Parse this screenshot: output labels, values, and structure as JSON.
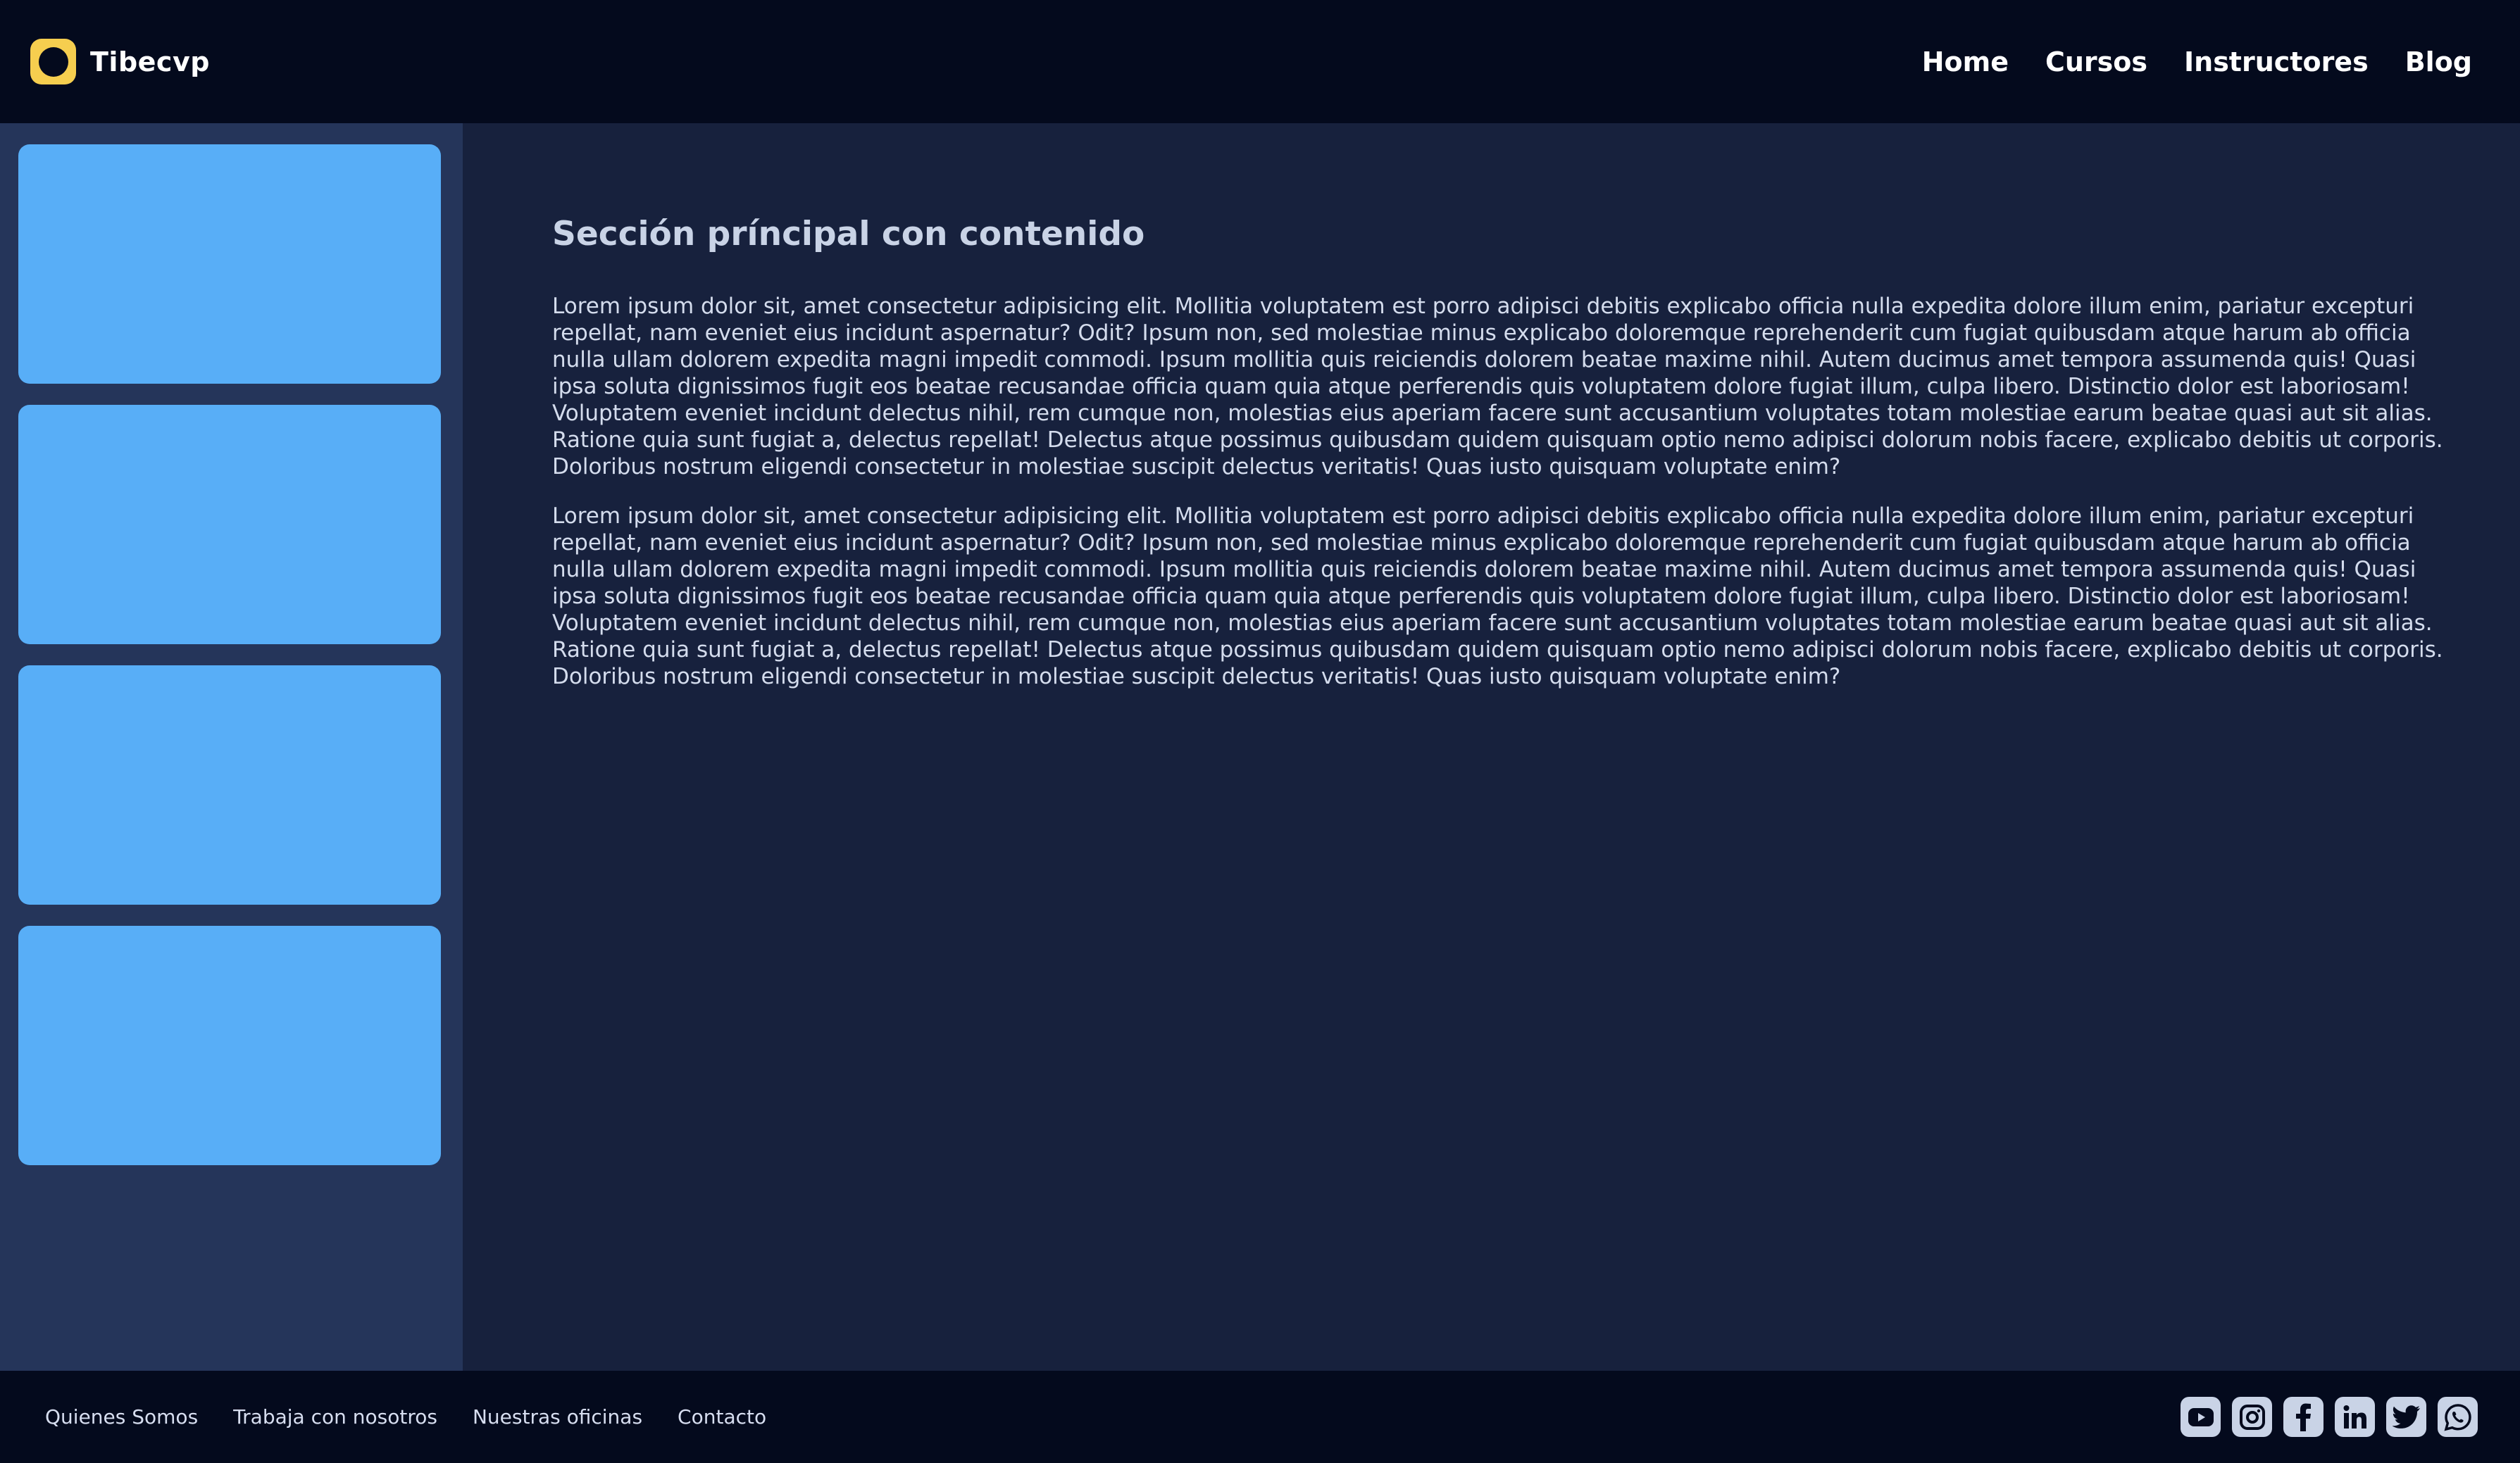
{
  "brand": {
    "name": "Tibecvp",
    "logo_color": "#f6ce4f"
  },
  "nav": {
    "items": [
      {
        "label": "Home"
      },
      {
        "label": "Cursos"
      },
      {
        "label": "Instructores"
      },
      {
        "label": "Blog"
      }
    ]
  },
  "sidebar": {
    "card_color": "#58aef7",
    "card_count": 4
  },
  "main": {
    "title": "Sección príncipal con contenido",
    "paragraphs": [
      "Lorem ipsum dolor sit, amet consectetur adipisicing elit. Mollitia voluptatem est porro adipisci debitis explicabo officia nulla expedita dolore illum enim, pariatur excepturi repellat, nam eveniet eius incidunt aspernatur? Odit? Ipsum non, sed molestiae minus explicabo doloremque reprehenderit cum fugiat quibusdam atque harum ab officia nulla ullam dolorem expedita magni impedit commodi. Ipsum mollitia quis reiciendis dolorem beatae maxime nihil. Autem ducimus amet tempora assumenda quis! Quasi ipsa soluta dignissimos fugit eos beatae recusandae officia quam quia atque perferendis quis voluptatem dolore fugiat illum, culpa libero. Distinctio dolor est laboriosam! Voluptatem eveniet incidunt delectus nihil, rem cumque non, molestias eius aperiam facere sunt accusantium voluptates totam molestiae earum beatae quasi aut sit alias. Ratione quia sunt fugiat a, delectus repellat! Delectus atque possimus quibusdam quidem quisquam optio nemo adipisci dolorum nobis facere, explicabo debitis ut corporis. Doloribus nostrum eligendi consectetur in molestiae suscipit delectus veritatis! Quas iusto quisquam voluptate enim?",
      "Lorem ipsum dolor sit, amet consectetur adipisicing elit. Mollitia voluptatem est porro adipisci debitis explicabo officia nulla expedita dolore illum enim, pariatur excepturi repellat, nam eveniet eius incidunt aspernatur? Odit? Ipsum non, sed molestiae minus explicabo doloremque reprehenderit cum fugiat quibusdam atque harum ab officia nulla ullam dolorem expedita magni impedit commodi. Ipsum mollitia quis reiciendis dolorem beatae maxime nihil. Autem ducimus amet tempora assumenda quis! Quasi ipsa soluta dignissimos fugit eos beatae recusandae officia quam quia atque perferendis quis voluptatem dolore fugiat illum, culpa libero. Distinctio dolor est laboriosam! Voluptatem eveniet incidunt delectus nihil, rem cumque non, molestias eius aperiam facere sunt accusantium voluptates totam molestiae earum beatae quasi aut sit alias. Ratione quia sunt fugiat a, delectus repellat! Delectus atque possimus quibusdam quidem quisquam optio nemo adipisci dolorum nobis facere, explicabo debitis ut corporis. Doloribus nostrum eligendi consectetur in molestiae suscipit delectus veritatis! Quas iusto quisquam voluptate enim?"
    ]
  },
  "footer": {
    "links": [
      {
        "label": "Quienes Somos"
      },
      {
        "label": "Trabaja con nosotros"
      },
      {
        "label": "Nuestras oficinas"
      },
      {
        "label": "Contacto"
      }
    ],
    "socials": [
      {
        "icon": "youtube-icon"
      },
      {
        "icon": "instagram-icon"
      },
      {
        "icon": "facebook-icon"
      },
      {
        "icon": "linkedin-icon"
      },
      {
        "icon": "twitter-icon"
      },
      {
        "icon": "whatsapp-icon"
      }
    ]
  },
  "colors": {
    "header_bg": "#040a1d",
    "sidebar_bg": "#25355a",
    "main_bg": "#17213d",
    "footer_bg": "#040a1d"
  }
}
